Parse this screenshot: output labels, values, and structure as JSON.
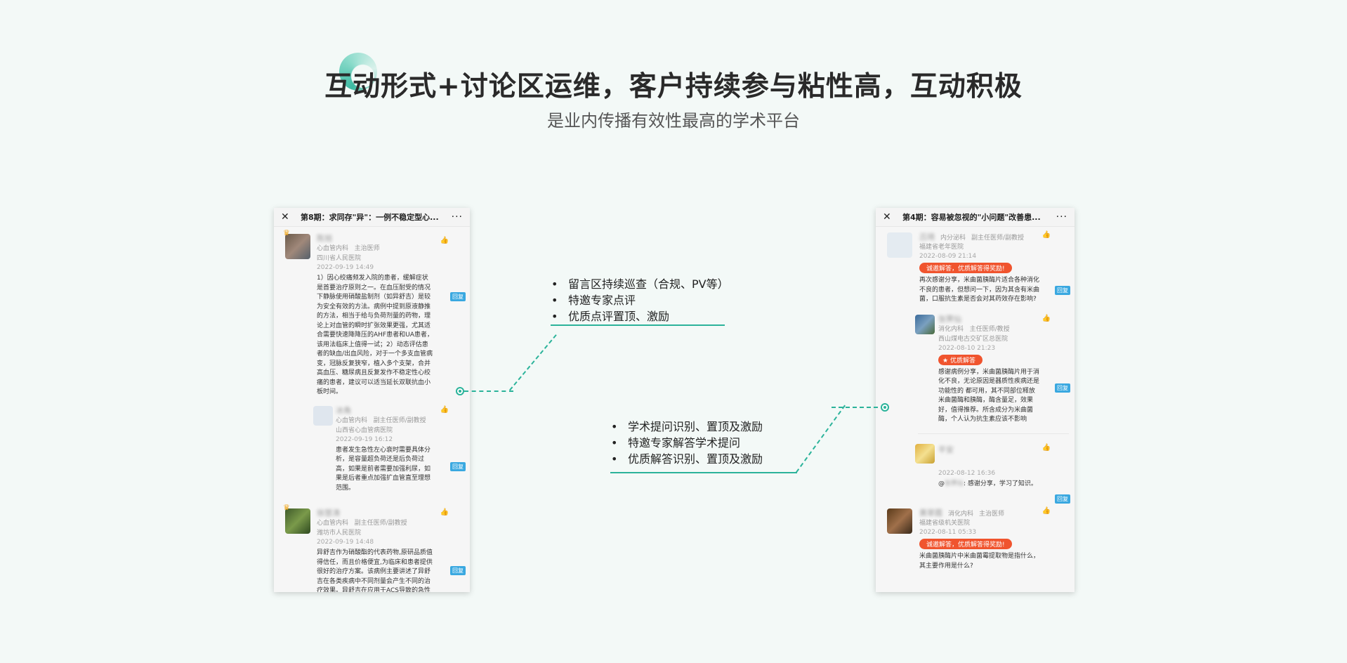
{
  "hero": {
    "title": "互动形式+讨论区运维，客户持续参与粘性高，互动积极",
    "subtitle": "是业内传播有效性最高的学术平台"
  },
  "colors": {
    "accent": "#2bb39a",
    "badge": "#f0542e",
    "reply": "#3aa8e0",
    "background": "#f3f9f7"
  },
  "left_phone": {
    "close": "✕",
    "title": "第8期：求同存\"异\"：一例不稳定型心...",
    "more": "···",
    "reply_label": "回复",
    "comments": [
      {
        "name": "陈旭",
        "dept": "心血管内科",
        "role": "主治医师",
        "hospital": "四川省人民医院",
        "date": "2022-09-19 14:49",
        "body": "1）因心绞痛频发入院的患者，缓解症状是首要治疗原则之一。在血压耐受的情况下静脉使用硝酸盐制剂（如异舒吉）是较为安全有效的方法。病例中提到原液静推的方法，相当于给与负荷剂量的药物，理论上对血管的瞬时扩张效果更强，尤其适合需要快速降降压的AHF患者和UA患者，该用法临床上值得一试；2）动态评估患者的缺血/出血风险，对于一个多支血管病变，冠脉反复狭窄，植入多个支架，合并高血压、糖尿病且反复发作不稳定性心绞痛的患者，建议可以适当延长双联抗血小板时间。"
      },
      {
        "name": "冰角",
        "dept": "心血管内科",
        "role": "副主任医师/副教授",
        "hospital": "山西省心血管病医院",
        "date": "2022-09-19 16:12",
        "body": "患者发生急性左心衰时需要具体分析，是容量超负荷还是后负荷过高，如果是前者需要加强利尿，如果是后者重点加强扩血管直至理想范围。"
      },
      {
        "name": "徐慧涛",
        "dept": "心血管内科",
        "role": "副主任医师/副教授",
        "hospital": "潍坊市人民医院",
        "date": "2022-09-19 14:48",
        "body": "异舒吉作为硝酸酯的代表药物,原研品质值得信任，而且价格便宜,为临床和患者提供很好的治疗方案。该病例主要讲述了异舒吉在各类疾病中不同剂量会产生不同的治疗效果。异舒吉在应用于ACS导致的急性心衰伴高血"
      }
    ]
  },
  "right_phone": {
    "close": "✕",
    "title": "第4期：容易被忽视的\"小问题\"改善患...",
    "more": "···",
    "reply_label": "回复",
    "comments": [
      {
        "name": "吕琦",
        "dept": "内分泌科",
        "role": "副主任医师/副教授",
        "hospital": "福建省老年医院",
        "date": "2022-08-09 21:14",
        "badge": "诚邀解答，优质解答得奖励!",
        "body": "再次感谢分享，米曲菌胰酶片适合各种消化不良的患者，但想问一下，因为其含有米曲菌，口服抗生素是否会对其药效存在影响?"
      },
      {
        "name": "张霁仙",
        "dept": "消化内科",
        "role": "主任医师/教授",
        "hospital": "西山煤电古交矿区总医院",
        "date": "2022-08-10 21:23",
        "badge": "优质解答",
        "body": "感谢病例分享，米曲菌胰酶片用于消化不良，无论原因是器质性疾病还是功能性的 都可用，其不同部位释放米曲菌酶和胰酶，酶含量足，效果好，值得推荐。所含成分为米曲菌酶，个人认为抗生素应该不影响"
      },
      {
        "name": "平安",
        "date": "2022-08-12 16:36",
        "body_prefix": "@",
        "mention": "张霁仙",
        "body": ": 感谢分享，学习了知识。"
      },
      {
        "name": "黄翠霞",
        "dept": "消化内科",
        "role": "主治医师",
        "hospital": "福建省级机关医院",
        "date": "2022-08-11 05:33",
        "badge": "诚邀解答，优质解答得奖励!",
        "body": "米曲菌胰酶片中米曲菌霉提取物是指什么，其主要作用是什么?"
      }
    ]
  },
  "middle": {
    "top_bullets": [
      "留言区持续巡查（合规、PV等）",
      "特邀专家点评",
      "优质点评置顶、激励"
    ],
    "bottom_bullets": [
      "学术提问识别、置顶及激励",
      "特邀专家解答学术提问",
      "优质解答识别、置顶及激励"
    ]
  }
}
